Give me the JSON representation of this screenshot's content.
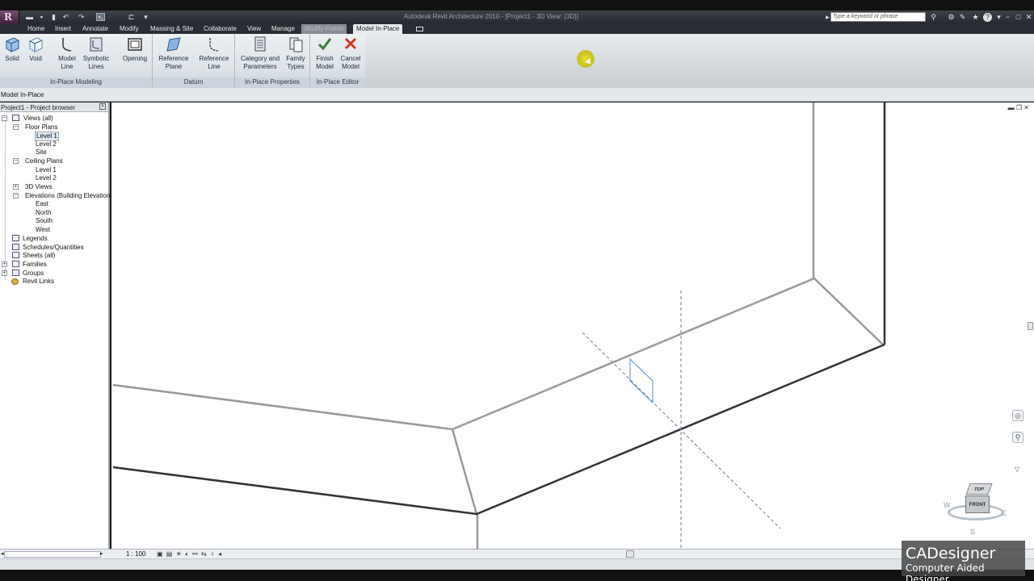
{
  "window": {
    "title": "Autodesk Revit Architecture 2010 - [Project1 - 3D View: {3D}]",
    "search_placeholder": "Type a keyword or phrase"
  },
  "tabs": [
    {
      "label": "Home"
    },
    {
      "label": "Insert"
    },
    {
      "label": "Annotate"
    },
    {
      "label": "Modify"
    },
    {
      "label": "Massing & Site"
    },
    {
      "label": "Collaborate"
    },
    {
      "label": "View"
    },
    {
      "label": "Manage"
    },
    {
      "label": "Modify Forms"
    },
    {
      "label": "Model In-Place"
    }
  ],
  "ribbon": {
    "panels": [
      {
        "label": "In-Place Modeling"
      },
      {
        "label": "Datum"
      },
      {
        "label": "In-Place Properties"
      },
      {
        "label": "In-Place Editor"
      }
    ],
    "buttons": {
      "solid": "Solid",
      "void": "Void",
      "model_line_1": "Model",
      "model_line_2": "Line",
      "symbolic_lines_1": "Symbolic",
      "symbolic_lines_2": "Lines",
      "opening": "Opening",
      "reference_plane_1": "Reference",
      "reference_plane_2": "Plane",
      "reference_line_1": "Reference",
      "reference_line_2": "Line",
      "category_params_1": "Category and",
      "category_params_2": "Parameters",
      "family_types_1": "Family",
      "family_types_2": "Types",
      "finish_model_1": "Finish",
      "finish_model_2": "Model",
      "cancel_model_1": "Cancel",
      "cancel_model_2": "Model"
    }
  },
  "options_bar": {
    "label": "Model In-Place"
  },
  "project_browser": {
    "title": "Project1 - Project browser",
    "views_all": "Views (all)",
    "floor_plans": "Floor Plans",
    "fp_level1": "Level 1",
    "fp_level2": "Level 2",
    "fp_site": "Site",
    "ceiling_plans": "Ceiling Plans",
    "cp_level1": "Level 1",
    "cp_level2": "Level 2",
    "views_3d": "3D Views",
    "elevations": "Elevations (Building Elevation",
    "east": "East",
    "north": "North",
    "south": "South",
    "west": "West",
    "legends": "Legends",
    "schedules": "Schedules/Quantities",
    "sheets": "Sheets (all)",
    "families": "Families",
    "groups": "Groups",
    "revit_links": "Revit Links"
  },
  "view_control_bar": {
    "scale": "1 : 100"
  },
  "viewcube": {
    "top": "TOP",
    "front": "FRONT",
    "w": "W",
    "e": "E",
    "s": "S"
  },
  "watermark": {
    "title": "CADesigner",
    "subtitle": "Computer Aided Designer"
  },
  "colors": {
    "accent_red": "#d23a2a",
    "finish_green": "#3a7a3a",
    "ref_plane": "#6a7aa8"
  }
}
